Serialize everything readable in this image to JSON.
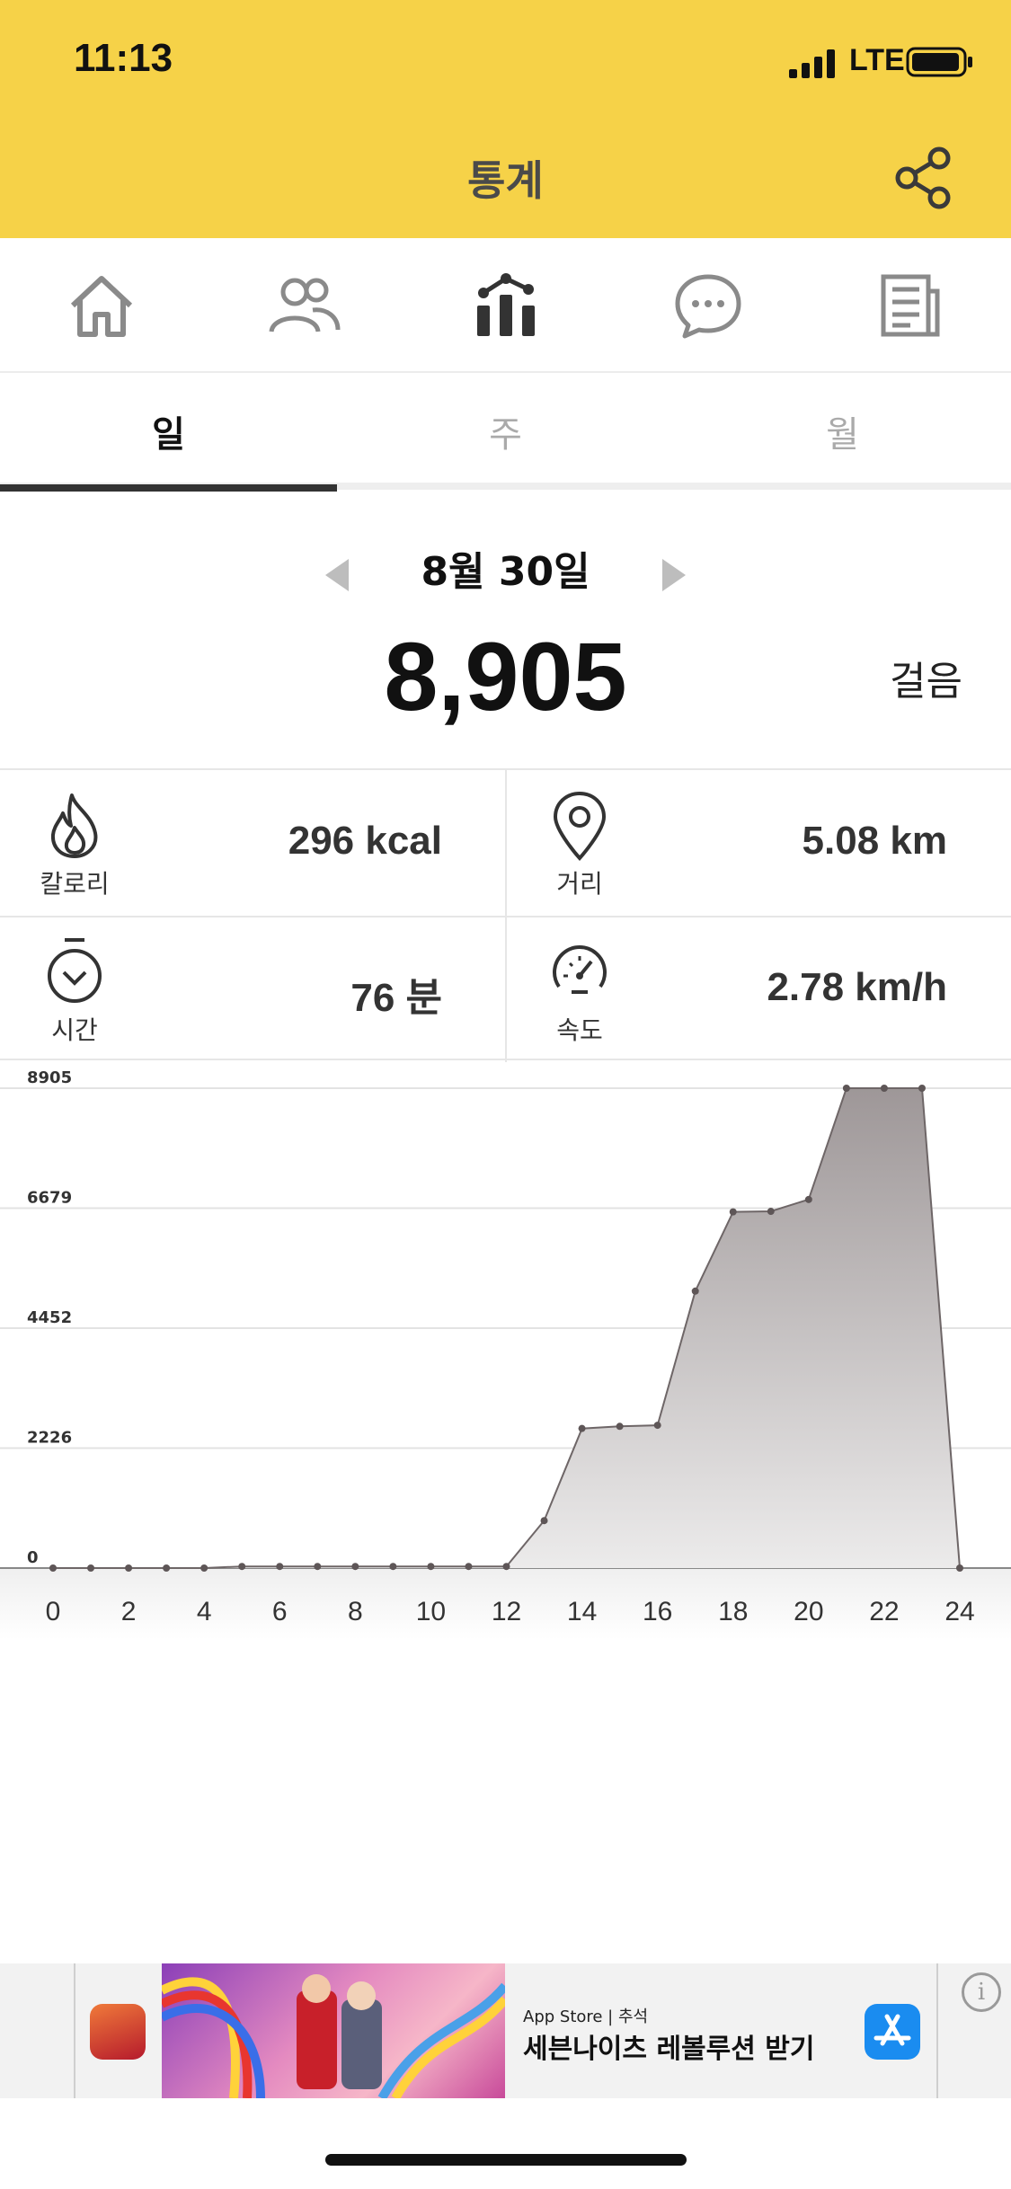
{
  "status_bar": {
    "time": "11:13",
    "network": "LTE"
  },
  "header": {
    "title": "통계"
  },
  "nav_icons": [
    "home-icon",
    "friends-icon",
    "stats-icon",
    "chat-icon",
    "news-icon"
  ],
  "period_tabs": {
    "day": "일",
    "week": "주",
    "month": "월",
    "selected": "일"
  },
  "day": {
    "date": "8월 30일",
    "steps": "8,905",
    "steps_unit": "걸음"
  },
  "stats": {
    "calories": {
      "label": "칼로리",
      "value": "296 kcal"
    },
    "distance": {
      "label": "거리",
      "value": "5.08 km"
    },
    "time": {
      "label": "시간",
      "value": "76 분"
    },
    "speed": {
      "label": "속도",
      "value": "2.78 km/h"
    }
  },
  "chart_data": {
    "type": "area",
    "x": [
      0,
      1,
      2,
      3,
      4,
      5,
      6,
      7,
      8,
      9,
      10,
      11,
      12,
      13,
      14,
      15,
      16,
      17,
      18,
      19,
      20,
      21,
      22,
      23,
      24
    ],
    "values": [
      0,
      0,
      0,
      0,
      0,
      30,
      30,
      30,
      30,
      30,
      30,
      30,
      30,
      880,
      2590,
      2630,
      2650,
      5140,
      6610,
      6620,
      6840,
      8905,
      8905,
      8905,
      0
    ],
    "x_ticks": [
      "0",
      "2",
      "4",
      "6",
      "8",
      "10",
      "12",
      "14",
      "16",
      "18",
      "20",
      "22",
      "24"
    ],
    "y_ticks": [
      "0",
      "2226",
      "4452",
      "6679",
      "8905"
    ],
    "ylim": [
      0,
      8905
    ],
    "grid": true
  },
  "ad": {
    "store_line": "App Store | 추석",
    "headline": "세븐나이츠 레볼루션 받기",
    "app_icon": "app-store-icon",
    "info_icon": "info-icon"
  }
}
